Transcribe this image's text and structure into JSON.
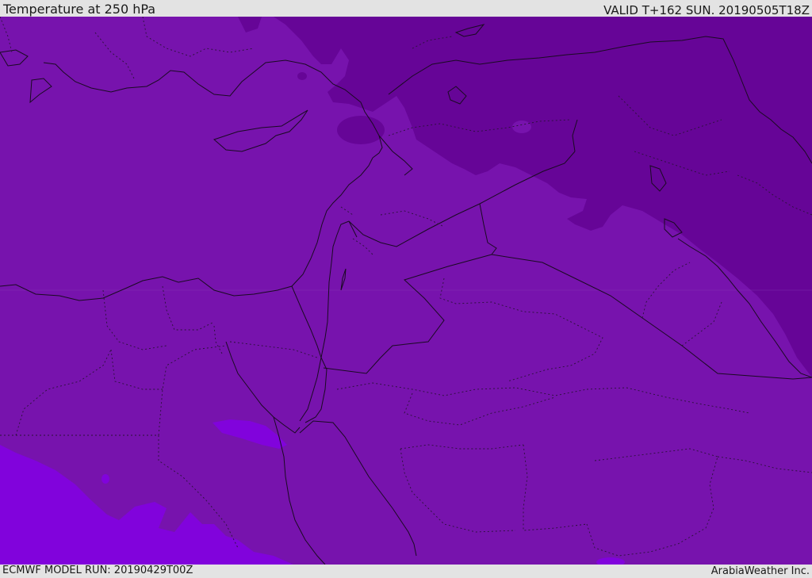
{
  "header": {
    "title": "Temperature at 250 hPa",
    "valid": "VALID T+162 SUN. 20190505T18Z"
  },
  "footer": {
    "model_run": "ECMWF MODEL RUN: 20190429T00Z",
    "credit": "ArabiaWeather Inc."
  },
  "map": {
    "field": "temperature",
    "level": "250 hPa",
    "colors": {
      "base": "#7713ad",
      "cold": "#660597",
      "warm": "#8103dc",
      "coast": "#1a0a22",
      "border": "#1a0a22"
    }
  }
}
